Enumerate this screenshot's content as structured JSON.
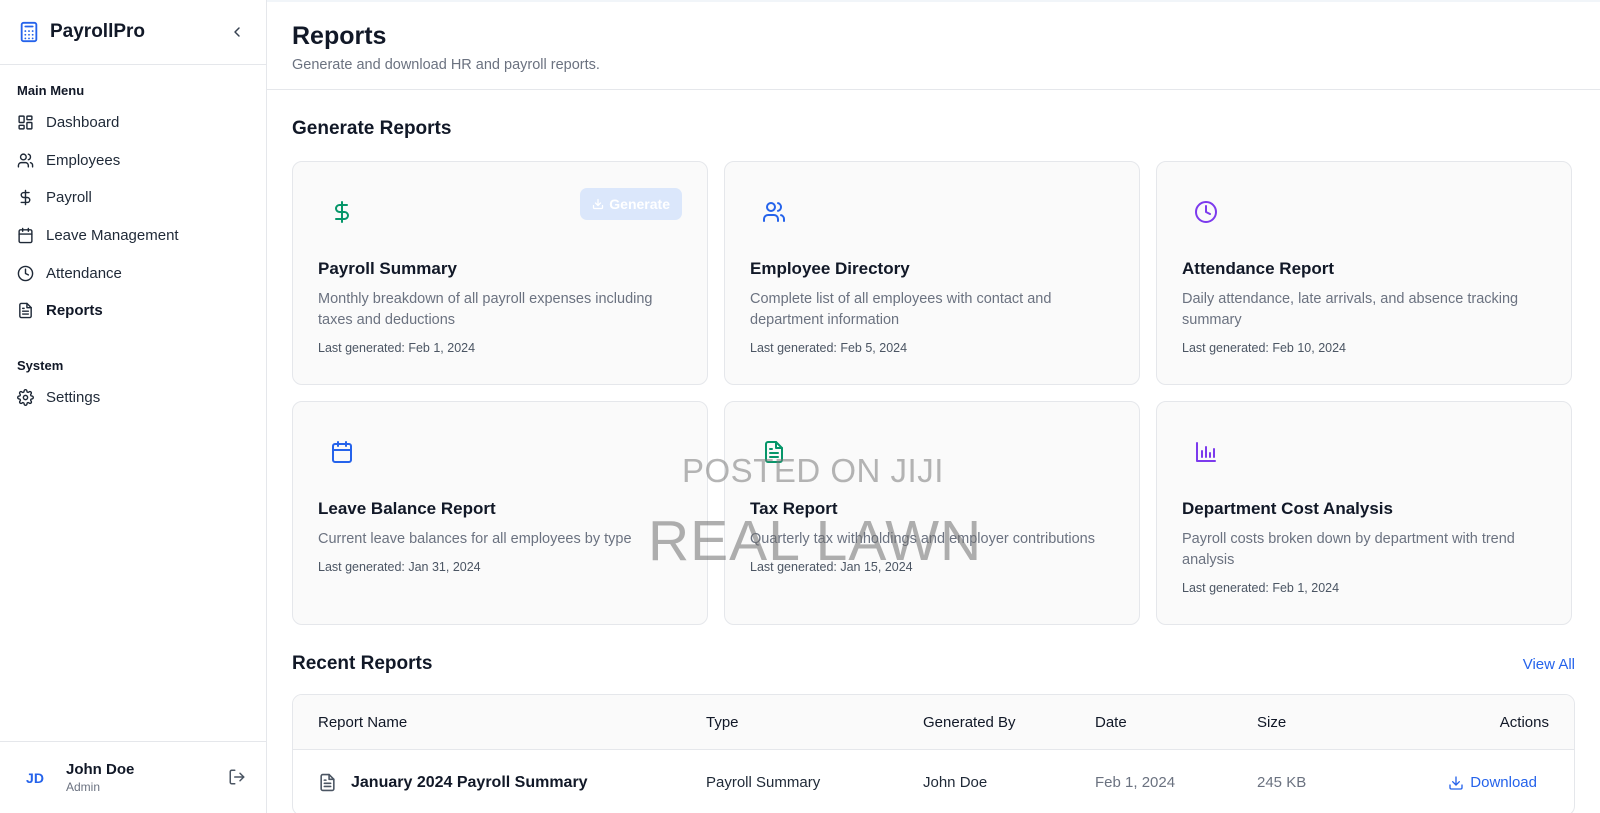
{
  "app": {
    "name": "PayrollPro"
  },
  "sidebar": {
    "main_heading": "Main Menu",
    "items": [
      {
        "label": "Dashboard",
        "icon": "grid-icon"
      },
      {
        "label": "Employees",
        "icon": "users-icon"
      },
      {
        "label": "Payroll",
        "icon": "dollar-icon"
      },
      {
        "label": "Leave Management",
        "icon": "calendar-icon"
      },
      {
        "label": "Attendance",
        "icon": "clock-icon"
      },
      {
        "label": "Reports",
        "icon": "file-text-icon",
        "active": true
      }
    ],
    "system_heading": "System",
    "system_items": [
      {
        "label": "Settings",
        "icon": "gear-icon"
      }
    ]
  },
  "user": {
    "initials": "JD",
    "name": "John Doe",
    "role": "Admin"
  },
  "header": {
    "title": "Reports",
    "subtitle": "Generate and download HR and payroll reports."
  },
  "generate": {
    "title": "Generate Reports",
    "button_label": "Generate",
    "cards": [
      {
        "title": "Payroll Summary",
        "desc": "Monthly breakdown of all payroll expenses including taxes and deductions",
        "last": "Last generated: Feb 1, 2024",
        "icon": "dollar-icon",
        "color": "#059669"
      },
      {
        "title": "Employee Directory",
        "desc": "Complete list of all employees with contact and department information",
        "last": "Last generated: Feb 5, 2024",
        "icon": "users-icon",
        "color": "#2563eb"
      },
      {
        "title": "Attendance Report",
        "desc": "Daily attendance, late arrivals, and absence tracking summary",
        "last": "Last generated: Feb 10, 2024",
        "icon": "clock-icon",
        "color": "#7c3aed"
      },
      {
        "title": "Leave Balance Report",
        "desc": "Current leave balances for all employees by type",
        "last": "Last generated: Jan 31, 2024",
        "icon": "calendar-icon",
        "color": "#2563eb"
      },
      {
        "title": "Tax Report",
        "desc": "Quarterly tax withholdings and employer contributions",
        "last": "Last generated: Jan 15, 2024",
        "icon": "file-text-icon",
        "color": "#059669"
      },
      {
        "title": "Department Cost Analysis",
        "desc": "Payroll costs broken down by department with trend analysis",
        "last": "Last generated: Feb 1, 2024",
        "icon": "bar-chart-icon",
        "color": "#7c3aed"
      }
    ]
  },
  "recent": {
    "title": "Recent Reports",
    "view_all": "View All",
    "columns": {
      "name": "Report Name",
      "type": "Type",
      "by": "Generated By",
      "date": "Date",
      "size": "Size",
      "actions": "Actions"
    },
    "rows": [
      {
        "name": "January 2024 Payroll Summary",
        "type": "Payroll Summary",
        "by": "John Doe",
        "date": "Feb 1, 2024",
        "size": "245 KB",
        "action": "Download"
      }
    ]
  },
  "watermark": {
    "line1": "POSTED ON JIJI",
    "line2": "REAL LAWN"
  }
}
